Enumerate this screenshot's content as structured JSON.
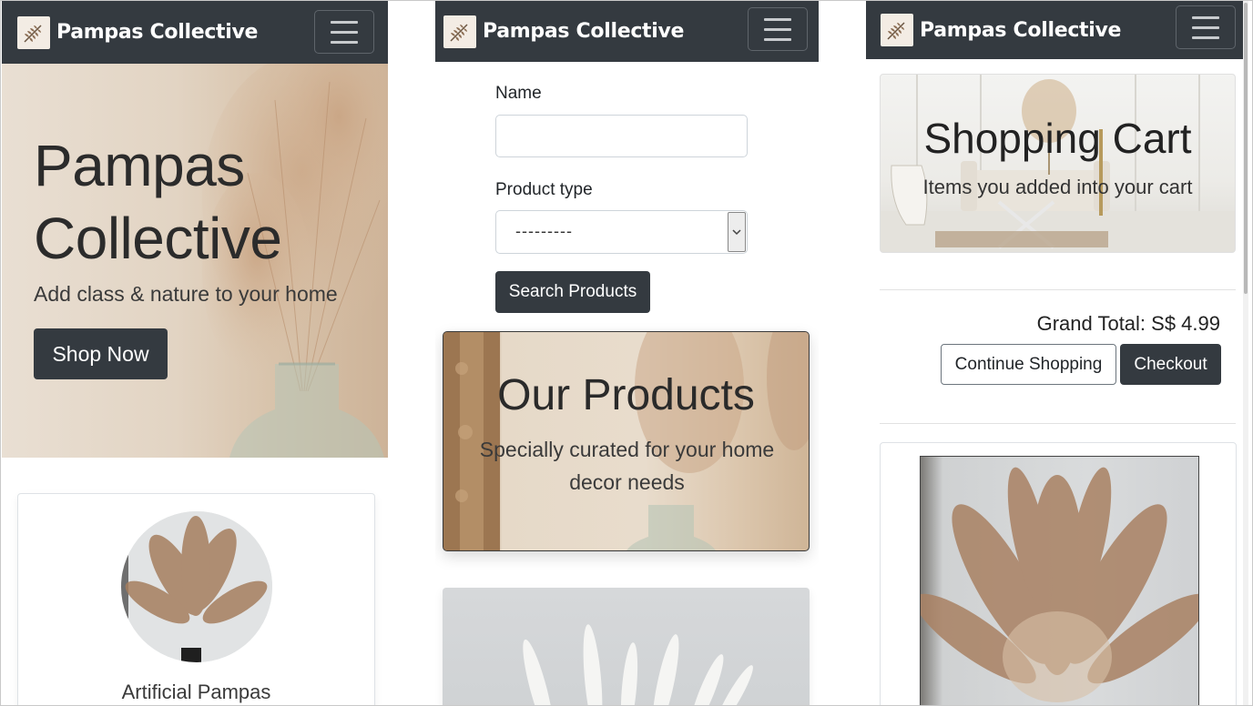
{
  "brand": {
    "name": "Pampas Collective"
  },
  "home": {
    "hero_title_line1": "Pampas",
    "hero_title_line2": "Collective",
    "hero_subtitle": "Add class & nature to your home",
    "shop_button": "Shop Now",
    "featured_product": "Artificial Pampas"
  },
  "products": {
    "name_label": "Name",
    "name_value": "",
    "product_type_label": "Product type",
    "product_type_selected": "---------",
    "search_button": "Search Products",
    "banner_title": "Our Products",
    "banner_subtitle": "Specially curated for your home decor needs"
  },
  "cart": {
    "banner_title": "Shopping Cart",
    "banner_subtitle": "Items you added into your cart",
    "grand_total": "Grand Total: S$ 4.99",
    "continue_button": "Continue Shopping",
    "checkout_button": "Checkout"
  },
  "colors": {
    "navbar": "#343a40",
    "button_dark": "#343a40",
    "page_background": "#ffffff"
  },
  "icons": {
    "logo": "pampas-leaf-icon",
    "menu": "hamburger-menu-icon",
    "select": "chevron-down-icon"
  }
}
